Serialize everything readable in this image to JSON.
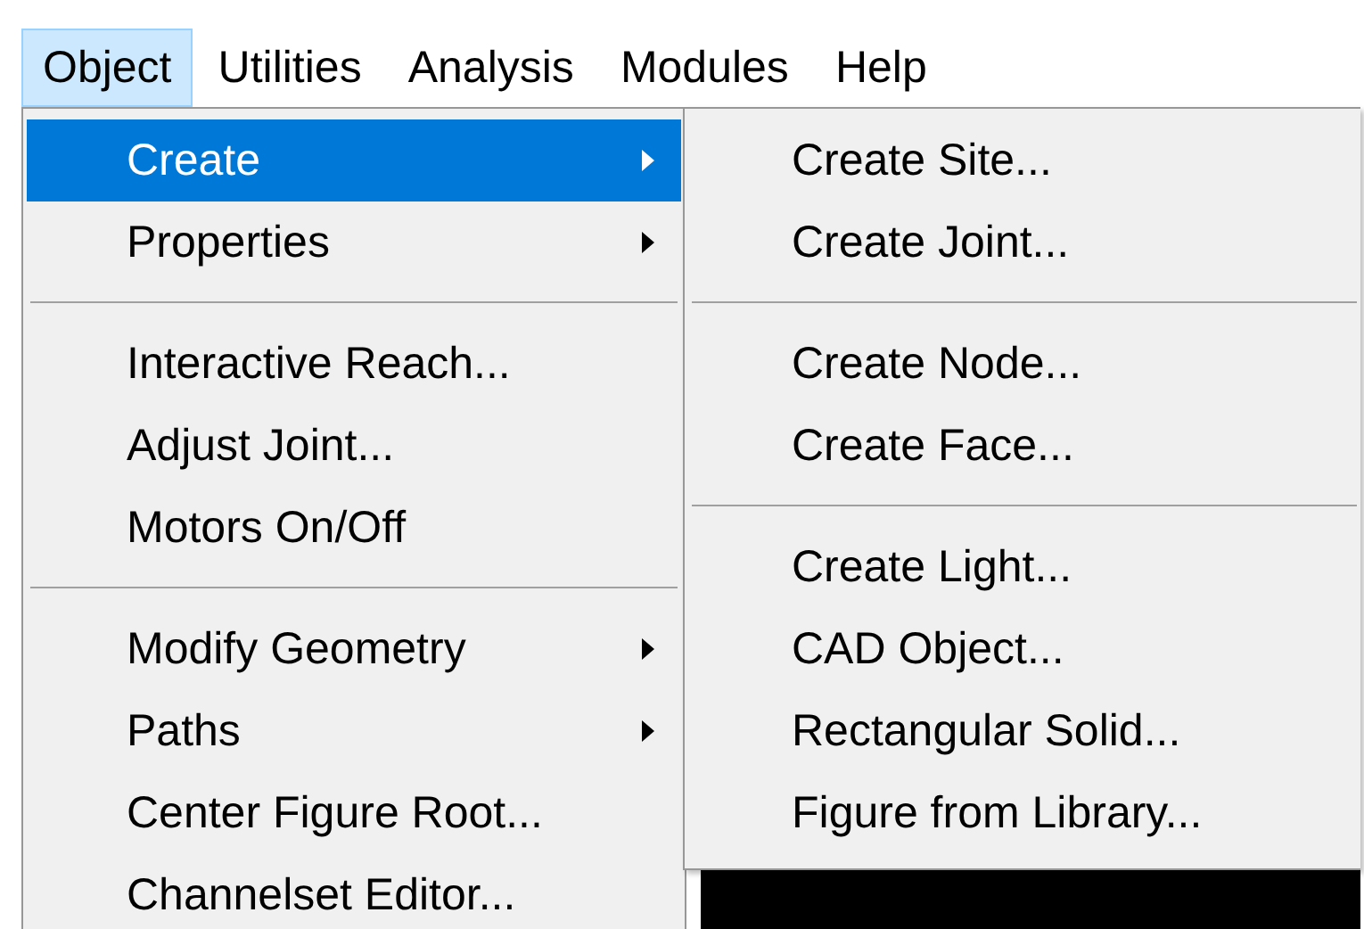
{
  "menubar": [
    {
      "label": "Object",
      "selected": true
    },
    {
      "label": "Utilities",
      "selected": false
    },
    {
      "label": "Analysis",
      "selected": false
    },
    {
      "label": "Modules",
      "selected": false
    },
    {
      "label": "Help",
      "selected": false
    }
  ],
  "menu": {
    "items": [
      {
        "kind": "item",
        "label": "Create",
        "submenu": true,
        "selected": true
      },
      {
        "kind": "item",
        "label": "Properties",
        "submenu": true,
        "selected": false
      },
      {
        "kind": "separator"
      },
      {
        "kind": "item",
        "label": "Interactive Reach...",
        "submenu": false,
        "selected": false
      },
      {
        "kind": "item",
        "label": "Adjust Joint...",
        "submenu": false,
        "selected": false
      },
      {
        "kind": "item",
        "label": "Motors On/Off",
        "submenu": false,
        "selected": false
      },
      {
        "kind": "separator"
      },
      {
        "kind": "item",
        "label": "Modify Geometry",
        "submenu": true,
        "selected": false
      },
      {
        "kind": "item",
        "label": "Paths",
        "submenu": true,
        "selected": false
      },
      {
        "kind": "item",
        "label": "Center Figure Root...",
        "submenu": false,
        "selected": false
      },
      {
        "kind": "item",
        "label": "Channelset Editor...",
        "submenu": false,
        "selected": false
      }
    ]
  },
  "submenu": {
    "items": [
      {
        "kind": "item",
        "label": "Create Site..."
      },
      {
        "kind": "item",
        "label": "Create Joint..."
      },
      {
        "kind": "separator"
      },
      {
        "kind": "item",
        "label": "Create Node..."
      },
      {
        "kind": "item",
        "label": "Create Face..."
      },
      {
        "kind": "separator"
      },
      {
        "kind": "item",
        "label": "Create Light..."
      },
      {
        "kind": "item",
        "label": "CAD Object..."
      },
      {
        "kind": "item",
        "label": "Rectangular Solid..."
      },
      {
        "kind": "item",
        "label": "Figure from Library..."
      }
    ]
  }
}
